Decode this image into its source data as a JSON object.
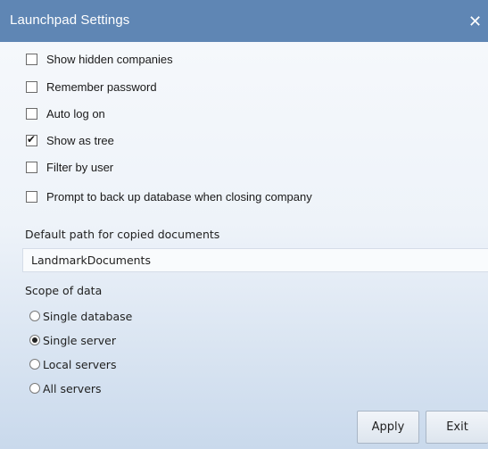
{
  "window": {
    "title": "Launchpad Settings",
    "close_glyph": "✕"
  },
  "options": [
    {
      "label": "Show hidden companies",
      "checked": false
    },
    {
      "label": "Remember password",
      "checked": false
    },
    {
      "label": "Auto log on",
      "checked": false
    },
    {
      "label": "Show as tree",
      "checked": true
    },
    {
      "label": "Filter by user",
      "checked": false
    },
    {
      "label": "Prompt to back up database when closing company",
      "checked": false
    }
  ],
  "documents_path": {
    "label": "Default path for copied documents",
    "value": "LandmarkDocuments"
  },
  "scope": {
    "label": "Scope of data",
    "options": [
      {
        "label": "Single database",
        "selected": false
      },
      {
        "label": "Single server",
        "selected": true
      },
      {
        "label": "Local servers",
        "selected": false
      },
      {
        "label": "All servers",
        "selected": false
      }
    ]
  },
  "buttons": {
    "apply": "Apply",
    "exit": "Exit"
  },
  "colors": {
    "titlebar": "#5f86b4",
    "title_text": "#ffffff"
  },
  "icons": {
    "close": "close-icon",
    "check": "check-icon",
    "radio_dot": "radio-dot-icon"
  }
}
